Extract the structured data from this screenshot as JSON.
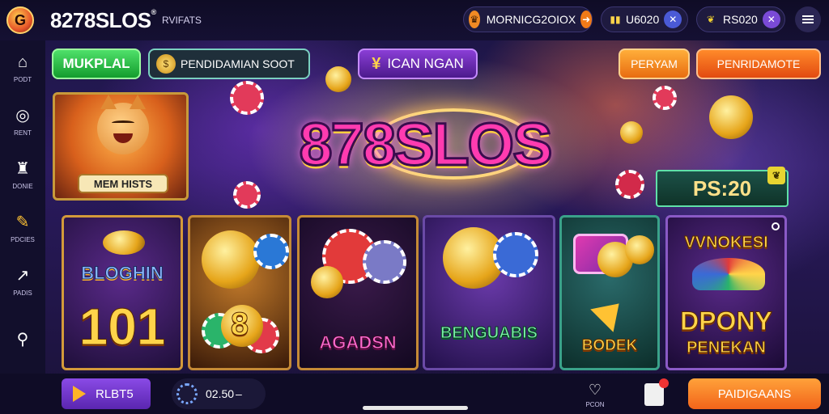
{
  "header": {
    "logo_glyph": "G",
    "title": "8278SLOS",
    "title_mark": "®",
    "subtitle": "RVIFATS",
    "balance": {
      "text": "MORNICG2OIOX",
      "lead_icon": "crown-icon",
      "trail_icon": "arrow-icon"
    },
    "coins": {
      "text": "U6020",
      "lead_icon": "bars-icon",
      "trail_icon": "x-icon"
    },
    "gems": {
      "text": "RS020",
      "lead_icon": "leaf-icon",
      "trail_icon": "x-icon"
    },
    "menu_icon": "hamburger-icon"
  },
  "sidebar": {
    "items": [
      {
        "icon": "home-icon",
        "glyph": "⌂",
        "label": "PODT"
      },
      {
        "icon": "target-icon",
        "glyph": "◎",
        "label": "RENT"
      },
      {
        "icon": "puzzle-icon",
        "glyph": "♜",
        "label": "DONIE"
      },
      {
        "icon": "edit-icon",
        "glyph": "✎",
        "label": "PDCIES"
      },
      {
        "icon": "share-icon",
        "glyph": "↗",
        "label": "PADIS"
      },
      {
        "icon": "search-icon",
        "glyph": "⚲",
        "label": ""
      }
    ]
  },
  "chips": {
    "green": "MUKPLAL",
    "dark": "PENDIDAMIAN SOOT",
    "dark_icon": "coin-icon",
    "purple": "ICAN NGAN",
    "purple_glyph": "¥",
    "orange1": "PERYAM",
    "orange2": "PENRIDAMOTE"
  },
  "hero": {
    "tile_label": "MEM HISTS",
    "logo_text": "878SLOS",
    "badge_text": "PS:20",
    "badge_icon": "leaf-icon"
  },
  "cards": [
    {
      "title": "BLOGHIN",
      "value": "101"
    },
    {
      "title": "",
      "value": "8"
    },
    {
      "title": "AGADSN",
      "value": ""
    },
    {
      "title": "BENGUABIS",
      "value": ""
    },
    {
      "title": "BODEK",
      "value": ""
    },
    {
      "title": "VVNOKESI",
      "value": "DPONY",
      "subtitle": "PENEKAN"
    }
  ],
  "bottom": {
    "play_label": "RLBT5",
    "bet_value": "02.50",
    "shop_label": "PCON",
    "cta_label": "PAIDIGAANS"
  },
  "colors": {
    "accent_purple": "#8a4ae6",
    "accent_orange": "#f2641a",
    "accent_green": "#139c2d",
    "gold": "#ffd44a"
  }
}
